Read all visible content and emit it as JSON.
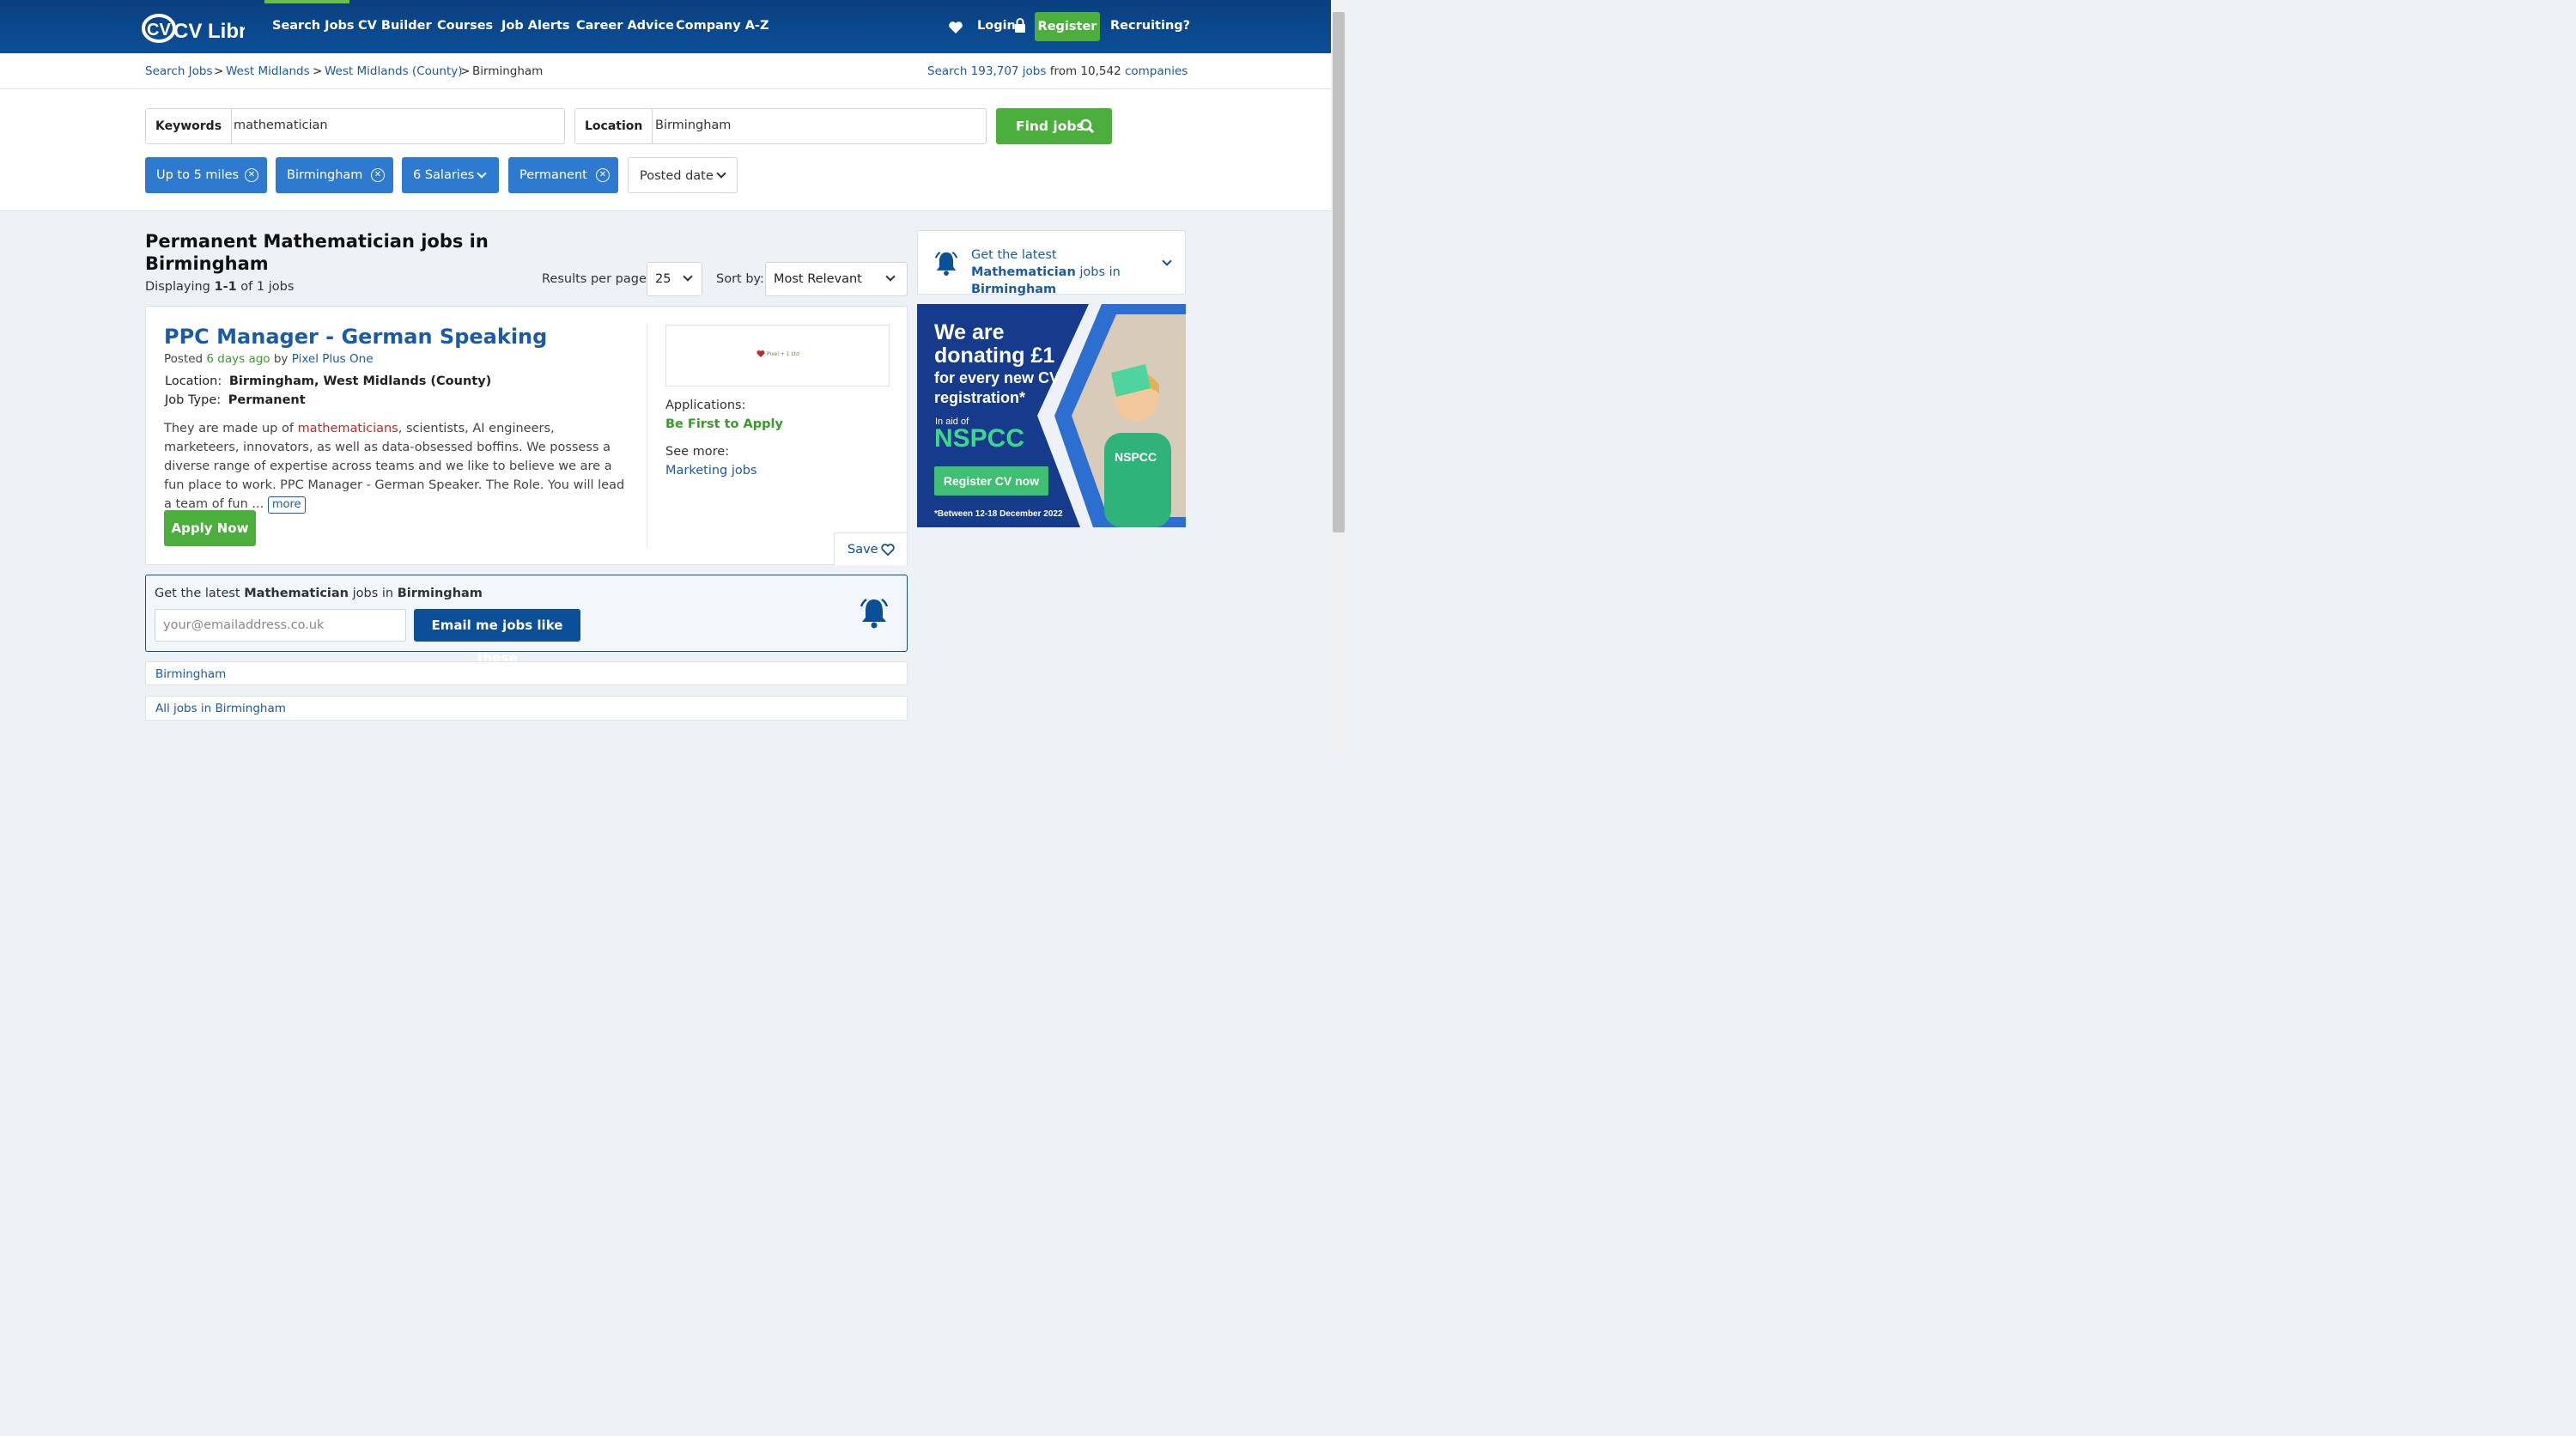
{
  "header": {
    "logo_text": "CV Library",
    "nav": [
      "Search Jobs",
      "CV Builder",
      "Courses",
      "Job Alerts",
      "Career Advice",
      "Company A-Z"
    ],
    "login": "Login",
    "register": "Register",
    "recruiting": "Recruiting?"
  },
  "breadcrumb": {
    "items": [
      "Search Jobs",
      "West Midlands",
      "West Midlands (County)",
      "Birmingham"
    ],
    "sep": ">",
    "stats_prefix": "Search 193,707",
    "stats_jobs": "jobs",
    "stats_from": "from 10,542",
    "stats_companies": "companies"
  },
  "search": {
    "keywords_label": "Keywords",
    "keywords_value": "mathematician",
    "location_label": "Location",
    "location_value": "Birmingham",
    "find_button": "Find jobs"
  },
  "filters": [
    "Up to 5 miles",
    "Birmingham",
    "6 Salaries",
    "Permanent",
    "Posted date"
  ],
  "results": {
    "heading": "Permanent Mathematician jobs in Birmingham",
    "displaying_prefix": "Displaying",
    "displaying_range": "1-1",
    "displaying_suffix": "of 1 jobs",
    "per_page_label": "Results per page:",
    "per_page_value": "25",
    "sort_label": "Sort by:",
    "sort_value": "Most Relevant"
  },
  "job": {
    "title": "PPC Manager - German Speaking",
    "posted_prefix": "Posted",
    "posted_when": "6 days ago",
    "posted_by": "by",
    "company": "Pixel Plus One",
    "location_label": "Location:",
    "location_value": "Birmingham, West Midlands (County)",
    "type_label": "Job Type:",
    "type_value": "Permanent",
    "desc_before": "They are made up of ",
    "desc_highlight": "mathematicians",
    "desc_after": ", scientists, AI engineers, marketeers, innovators, as well as data-obsessed boffins. We possess a diverse range of expertise across teams and we like to believe we are a fun place to work. PPC Manager - German Speaker. The Role. You will lead a team of fun ...",
    "more": "more",
    "apply": "Apply Now",
    "logo_text": "Pixel + 1 Ltd",
    "applications_label": "Applications:",
    "applications_value": "Be First to Apply",
    "see_more_label": "See more:",
    "see_more_link": "Marketing jobs",
    "save": "Save"
  },
  "alert": {
    "text_prefix": "Get the latest",
    "keyword": "Mathematician",
    "text_mid": "jobs in",
    "place": "Birmingham",
    "email_placeholder": "your@emailaddress.co.uk",
    "button": "Email me jobs like these"
  },
  "links": [
    "Birmingham",
    "All jobs in Birmingham"
  ],
  "side_alert": {
    "prefix": "Get the latest",
    "keyword": "Mathematician",
    "mid": "jobs in",
    "place": "Birmingham"
  },
  "ad": {
    "line1": "We are",
    "line2": "donating £1",
    "line3": "for every new CV",
    "line4": "registration*",
    "aid": "In aid of",
    "charity": "NSPCC",
    "cta": "Register CV now",
    "footnote": "*Between 12-18 December 2022",
    "shirt": "NSPCC"
  },
  "colors": {
    "brand": "#0b4f98",
    "accent": "#4cae3c",
    "chip": "#2f7ad1"
  }
}
